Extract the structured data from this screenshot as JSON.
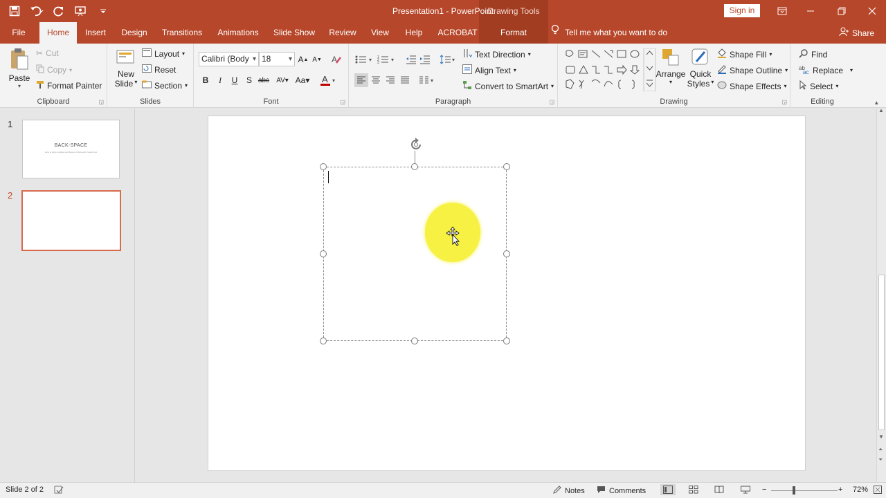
{
  "window": {
    "title": "Presentation1  -  PowerPoint",
    "context_title": "Drawing Tools",
    "sign_in": "Sign in"
  },
  "tabs": [
    "File",
    "Home",
    "Insert",
    "Design",
    "Transitions",
    "Animations",
    "Slide Show",
    "Review",
    "View",
    "Help",
    "ACROBAT",
    "Format"
  ],
  "active_tab": "Home",
  "tell_me": "Tell me what you want to do",
  "share": "Share",
  "ribbon": {
    "clipboard": {
      "label": "Clipboard",
      "paste": "Paste",
      "cut": "Cut",
      "copy": "Copy",
      "format_painter": "Format Painter"
    },
    "slides": {
      "label": "Slides",
      "new_slide_1": "New",
      "new_slide_2": "Slide",
      "layout": "Layout",
      "reset": "Reset",
      "section": "Section"
    },
    "font": {
      "label": "Font",
      "font_name": "Calibri (Body",
      "font_size": "18"
    },
    "paragraph": {
      "label": "Paragraph",
      "text_direction": "Text Direction",
      "align_text": "Align Text",
      "convert_smartart": "Convert to SmartArt"
    },
    "drawing": {
      "label": "Drawing",
      "arrange": "Arrange",
      "quick_1": "Quick",
      "quick_2": "Styles",
      "shape_fill": "Shape Fill",
      "shape_outline": "Shape Outline",
      "shape_effects": "Shape Effects"
    },
    "editing": {
      "label": "Editing",
      "find": "Find",
      "replace": "Replace",
      "select": "Select"
    }
  },
  "thumbnails": [
    {
      "num": "1",
      "title": "BACK-SPACE",
      "subtitle": "How to Align multiple text Boxes In Microsoft PowerPoint"
    },
    {
      "num": "2"
    }
  ],
  "status": {
    "slide": "Slide 2 of 2",
    "notes": "Notes",
    "comments": "Comments",
    "zoom": "72%"
  },
  "colors": {
    "accent": "#b7472a",
    "highlight": "#f6f142"
  }
}
